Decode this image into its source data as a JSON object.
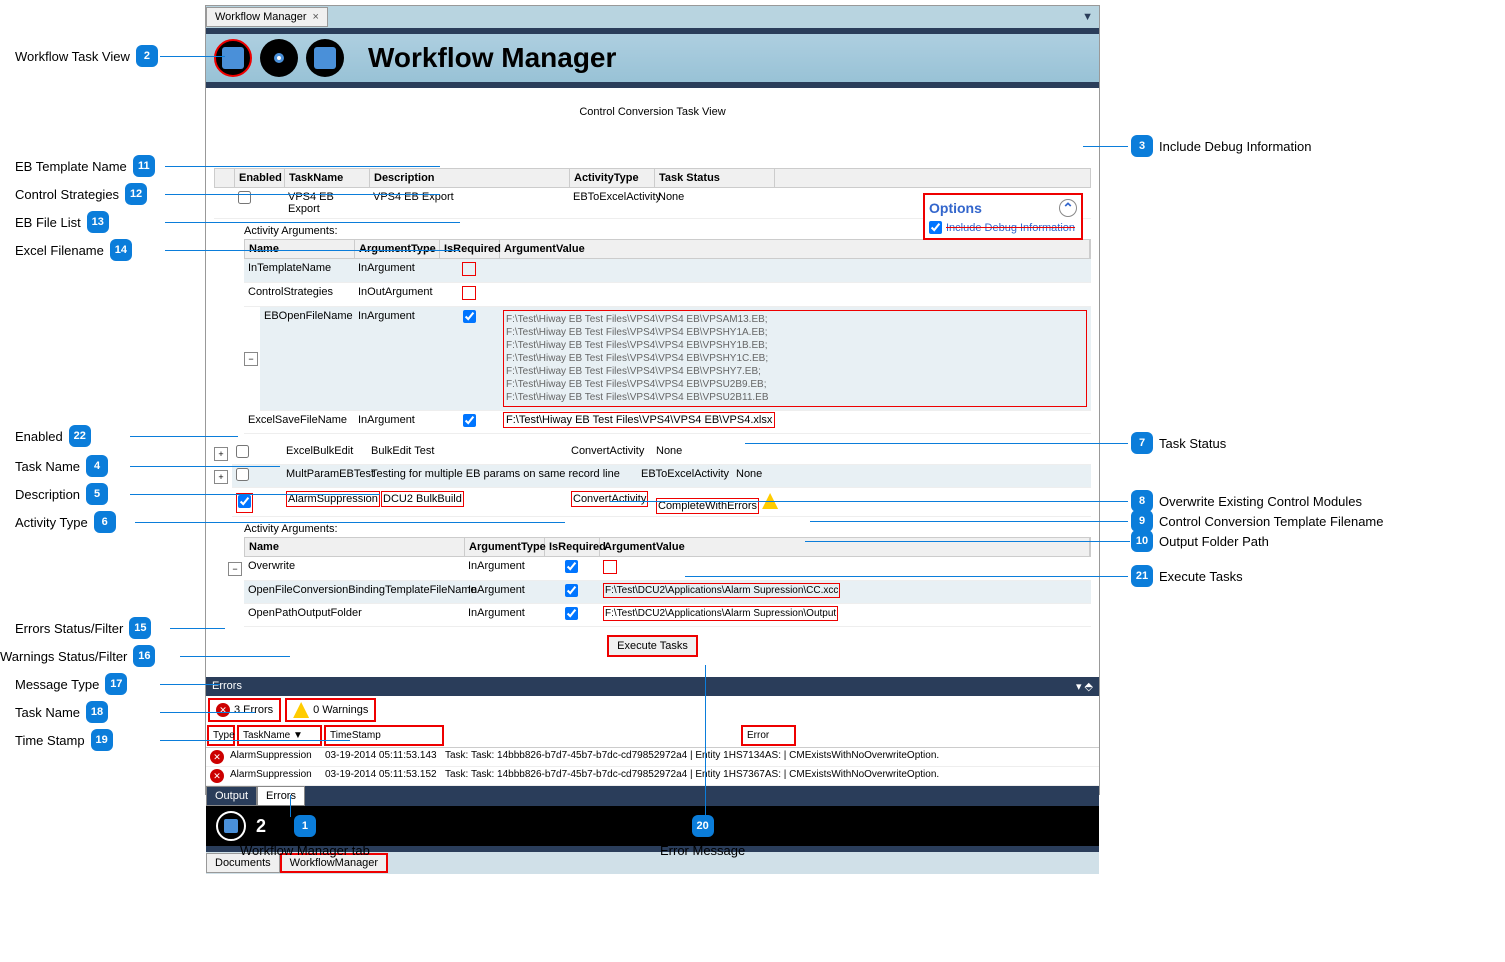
{
  "tab_title": "Workflow Manager",
  "header_title": "Workflow Manager",
  "content_title": "Control Conversion Task View",
  "options": {
    "title": "Options",
    "debug_label": "Include Debug Information"
  },
  "taskGridHeaders": {
    "enabled": "Enabled",
    "taskName": "TaskName",
    "description": "Description",
    "activityType": "ActivityType",
    "taskStatus": "Task Status"
  },
  "argsHeaders": {
    "name": "Name",
    "argType": "ArgumentType",
    "isRequired": "IsRequired",
    "argValue": "ArgumentValue"
  },
  "argsSectionLabel": "Activity Arguments:",
  "tasks": {
    "t1": {
      "name": "VPS4 EB Export",
      "desc": "VPS4 EB Export",
      "activity": "EBToExcelActivity",
      "status": "None"
    },
    "t2": {
      "name": "ExcelBulkEdit",
      "desc": "BulkEdit Test",
      "activity": "ConvertActivity",
      "status": "None"
    },
    "t3": {
      "name": "MultParamEBTest",
      "desc": "Testing  for multiple EB params on same record line",
      "activity": "EBToExcelActivity",
      "status": "None"
    },
    "t4": {
      "name": "AlarmSuppression",
      "desc": "DCU2 BulkBuild",
      "activity": "ConvertActivity",
      "status": "CompleteWithErrors"
    }
  },
  "args1": {
    "a1": {
      "name": "InTemplateName",
      "type": "InArgument"
    },
    "a2": {
      "name": "ControlStrategies",
      "type": "InOutArgument"
    },
    "a3": {
      "name": "EBOpenFileName",
      "type": "InArgument"
    },
    "a4": {
      "name": "ExcelSaveFileName",
      "type": "InArgument",
      "val": "F:\\Test\\Hiway EB Test Files\\VPS4\\VPS4 EB\\VPS4.xlsx"
    }
  },
  "ebFiles": [
    "F:\\Test\\Hiway EB Test Files\\VPS4\\VPS4 EB\\VPSAM13.EB;",
    "F:\\Test\\Hiway EB Test Files\\VPS4\\VPS4 EB\\VPSHY1A.EB;",
    "F:\\Test\\Hiway EB Test Files\\VPS4\\VPS4 EB\\VPSHY1B.EB;",
    "F:\\Test\\Hiway EB Test Files\\VPS4\\VPS4 EB\\VPSHY1C.EB;",
    "F:\\Test\\Hiway EB Test Files\\VPS4\\VPS4 EB\\VPSHY7.EB;",
    "F:\\Test\\Hiway EB Test Files\\VPS4\\VPS4 EB\\VPSU2B9.EB;",
    "F:\\Test\\Hiway EB Test Files\\VPS4\\VPS4 EB\\VPSU2B11.EB"
  ],
  "args2": {
    "a1": {
      "name": "Overwrite",
      "type": "InArgument"
    },
    "a2": {
      "name": "OpenFileConversionBindingTemplateFileName",
      "type": "InArgument",
      "val": "F:\\Test\\DCU2\\Applications\\Alarm Supression\\CC.xcc"
    },
    "a3": {
      "name": "OpenPathOutputFolder",
      "type": "InArgument",
      "val": "F:\\Test\\DCU2\\Applications\\Alarm Supression\\Output"
    }
  },
  "executeLabel": "Execute Tasks",
  "errors": {
    "title": "Errors",
    "errCount": "3 Errors",
    "warnCount": "0 Warnings",
    "cols": {
      "type": "Type",
      "taskName": "TaskName",
      "timestamp": "TimeStamp",
      "error": "Error"
    },
    "rows": [
      {
        "task": "AlarmSuppression",
        "ts": "03-19-2014 05:11:53.143",
        "msg": "Task: Task: 14bbb826-b7d7-45b7-b7dc-cd79852972a4 | Entity 1HS7134AS: | CMExistsWithNoOverwriteOption."
      },
      {
        "task": "AlarmSuppression",
        "ts": "03-19-2014 05:11:53.152",
        "msg": "Task: Task: 14bbb826-b7d7-45b7-b7dc-cd79852972a4 | Entity 1HS7367AS: | CMExistsWithNoOverwriteOption."
      }
    ]
  },
  "bottomTabs": {
    "output": "Output",
    "errors": "Errors"
  },
  "footerCount": "2",
  "docTabs": {
    "documents": "Documents",
    "wfm": "WorkflowManager"
  },
  "callouts": {
    "c1": "Workflow Manager tab",
    "c2": "Workflow Task View",
    "c3": "Include Debug Information",
    "c4": "Task Name",
    "c5": "Description",
    "c6": "Activity Type",
    "c7": "Task Status",
    "c8": "Overwrite Existing Control Modules",
    "c9": "Control Conversion Template Filename",
    "c10": "Output Folder Path",
    "c11": "EB Template Name",
    "c12": "Control Strategies",
    "c13": "EB File List",
    "c14": "Excel Filename",
    "c15": "Errors Status/Filter",
    "c16": "Warnings Status/Filter",
    "c17": "Message Type",
    "c18": "Task Name",
    "c19": "Time Stamp",
    "c20": "Error Message",
    "c21": "Execute Tasks",
    "c22": "Enabled"
  }
}
